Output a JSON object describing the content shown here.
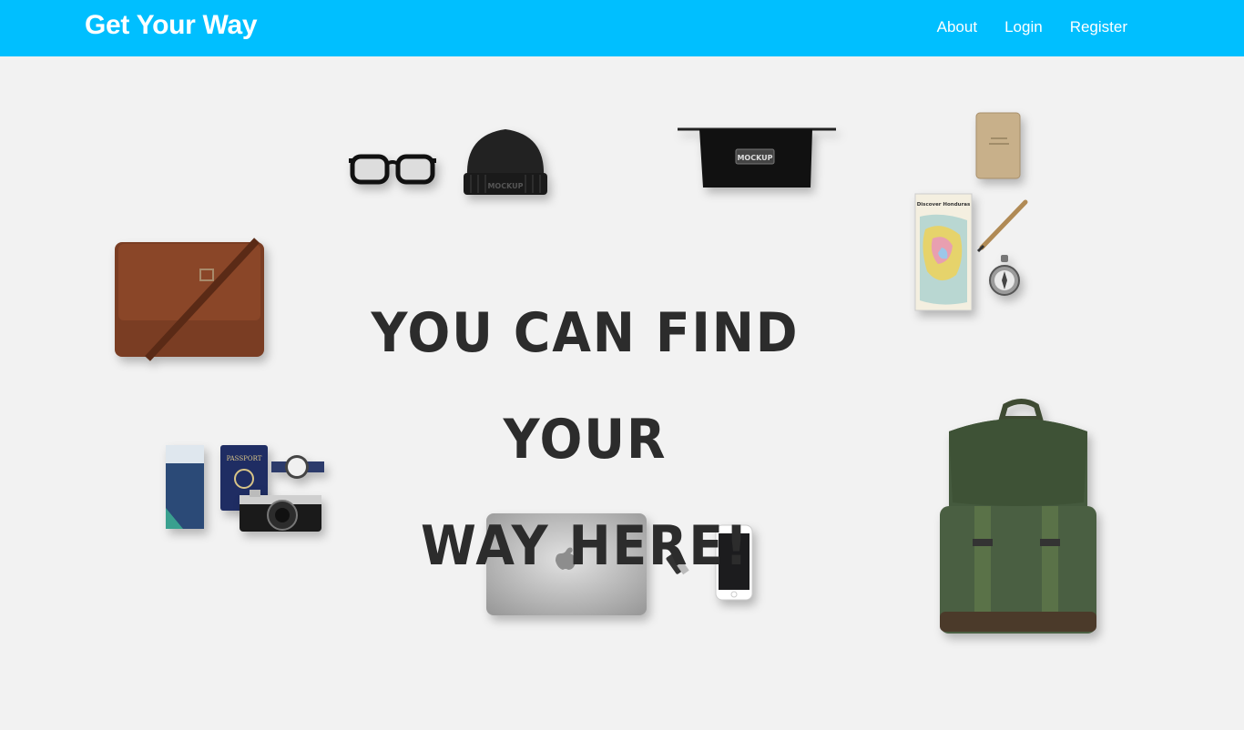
{
  "brand": "Get Your Way",
  "nav": {
    "about": "About",
    "login": "Login",
    "register": "Register"
  },
  "hero": {
    "line1": "YOU CAN FIND YOUR",
    "line2": "WAY HERE!"
  },
  "colors": {
    "navbar": "#00bfff",
    "background": "#f2f2f2",
    "headline": "#2c2c2c"
  },
  "illustrations": {
    "beanie_text": "MOCKUP",
    "pouch_text": "MOCKUP",
    "passport_text": "PASSPORT",
    "map_text": "Discover Honduras"
  }
}
